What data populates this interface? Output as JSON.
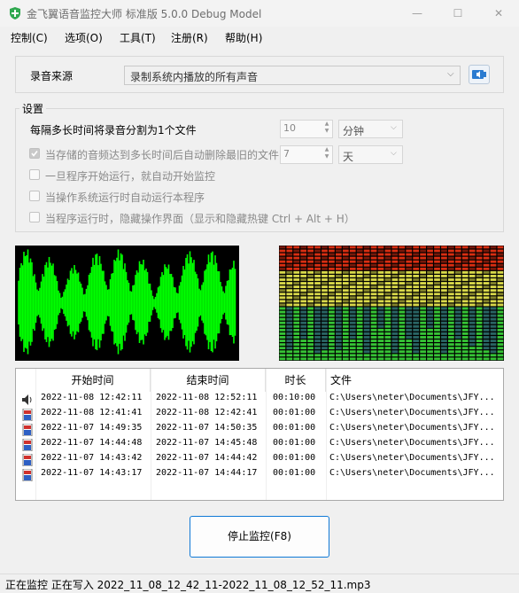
{
  "window": {
    "title": "金飞翼语音监控大师 标准版 5.0.0 Debug Model",
    "minimize": "—",
    "maximize": "☐",
    "close": "✕"
  },
  "menu": [
    "控制(C)",
    "选项(O)",
    "工具(T)",
    "注册(R)",
    "帮助(H)"
  ],
  "source": {
    "label": "录音来源",
    "selected": "录制系统内播放的所有声音"
  },
  "settings": {
    "title": "设置",
    "split_label": "每隔多长时间将录音分割为1个文件",
    "split_value": "10",
    "split_unit": "分钟",
    "keep_label": "当存储的音频达到多长时间后自动删除最旧的文件",
    "keep_value": "7",
    "keep_unit": "天",
    "auto_start_label": "一旦程序开始运行，就自动开始监控",
    "run_on_boot_label": "当操作系统运行时自动运行本程序",
    "hide_ui_label": "当程序运行时，隐藏操作界面（显示和隐藏热键 Ctrl + Alt + H）"
  },
  "table": {
    "headers": [
      "开始时间",
      "结束时间",
      "时长",
      "文件"
    ],
    "rows": [
      {
        "start": "2022-11-08 12:42:11",
        "end": "2022-11-08 12:52:11",
        "duration": "00:10:00",
        "file": "C:\\Users\\neter\\Documents\\JFY...",
        "icon": "speaker-icon"
      },
      {
        "start": "2022-11-08 12:41:41",
        "end": "2022-11-08 12:42:41",
        "duration": "00:01:00",
        "file": "C:\\Users\\neter\\Documents\\JFY...",
        "icon": "audio-file-icon"
      },
      {
        "start": "2022-11-07 14:49:35",
        "end": "2022-11-07 14:50:35",
        "duration": "00:01:00",
        "file": "C:\\Users\\neter\\Documents\\JFY...",
        "icon": "audio-file-icon"
      },
      {
        "start": "2022-11-07 14:44:48",
        "end": "2022-11-07 14:45:48",
        "duration": "00:01:00",
        "file": "C:\\Users\\neter\\Documents\\JFY...",
        "icon": "audio-file-icon"
      },
      {
        "start": "2022-11-07 14:43:42",
        "end": "2022-11-07 14:44:42",
        "duration": "00:01:00",
        "file": "C:\\Users\\neter\\Documents\\JFY...",
        "icon": "audio-file-icon"
      },
      {
        "start": "2022-11-07 14:43:17",
        "end": "2022-11-07 14:44:17",
        "duration": "00:01:00",
        "file": "C:\\Users\\neter\\Documents\\JFY...",
        "icon": "audio-file-icon"
      }
    ]
  },
  "stop_button": "停止监控(F8)",
  "status": "正在监控 正在写入 2022_11_08_12_42_11-2022_11_08_12_52_11.mp3",
  "colors": {
    "wave": "#00ff00",
    "spectrum_red": "#d92e12",
    "spectrum_yellow": "#d8d84a",
    "spectrum_green": "#36c436",
    "accent": "#0f79d6"
  }
}
